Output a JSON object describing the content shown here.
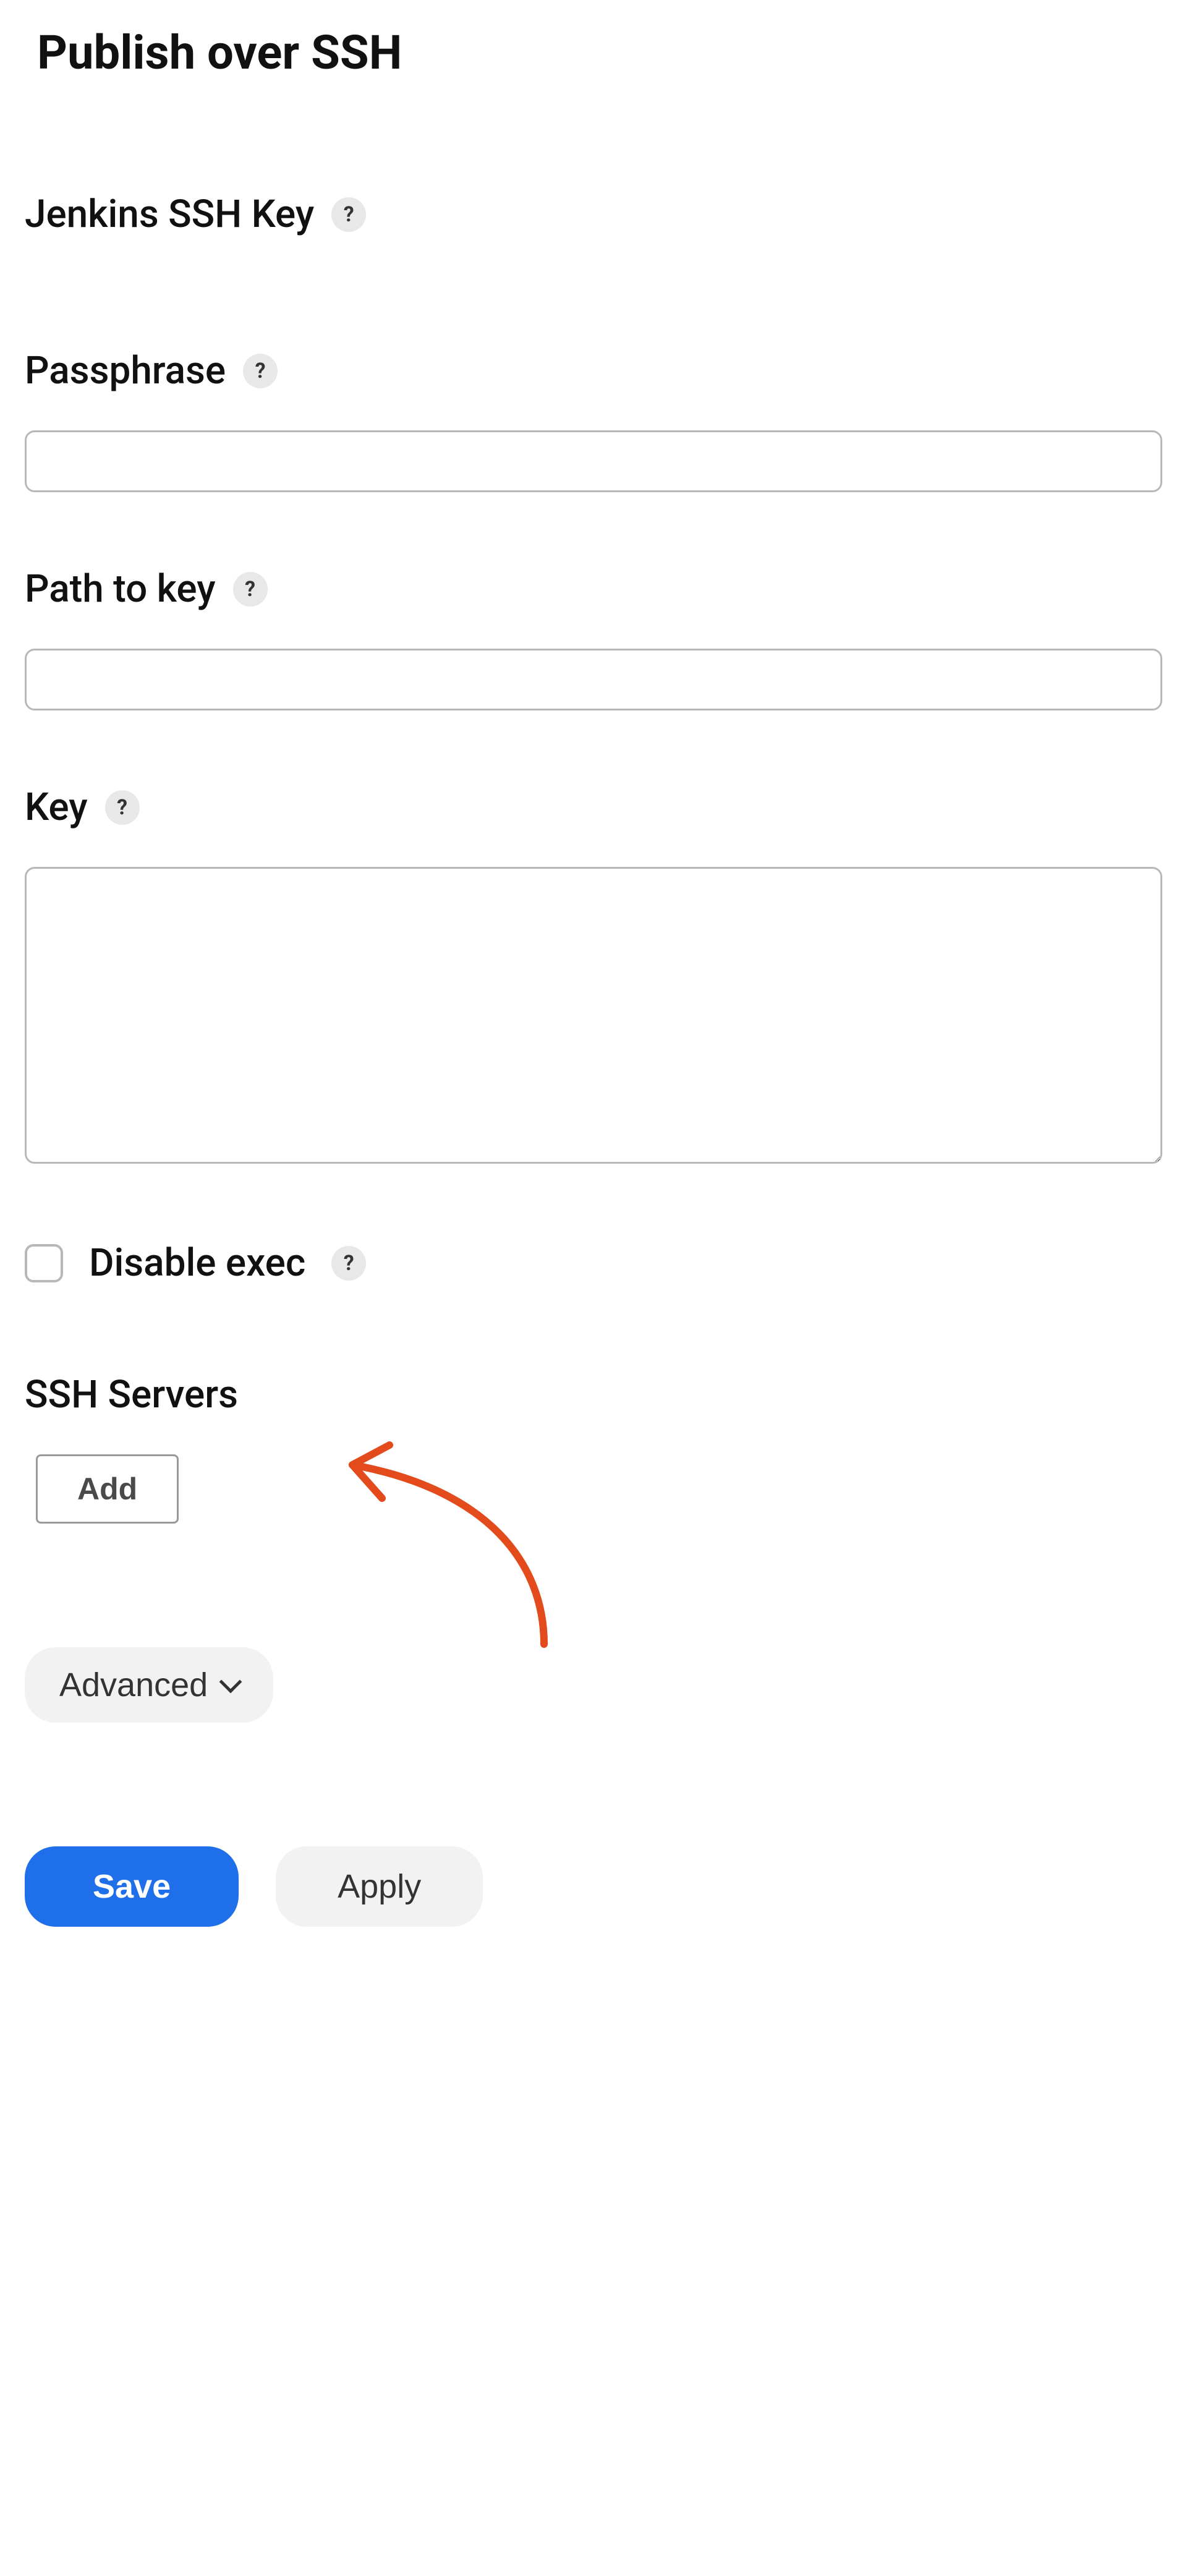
{
  "section": {
    "title": "Publish over SSH"
  },
  "jenkinsKey": {
    "heading": "Jenkins SSH Key"
  },
  "passphrase": {
    "label": "Passphrase",
    "value": ""
  },
  "pathToKey": {
    "label": "Path to key",
    "value": ""
  },
  "key": {
    "label": "Key",
    "value": ""
  },
  "disableExec": {
    "label": "Disable exec",
    "checked": false
  },
  "sshServers": {
    "heading": "SSH Servers",
    "addLabel": "Add",
    "advancedLabel": "Advanced"
  },
  "buttons": {
    "save": "Save",
    "apply": "Apply"
  },
  "helpGlyph": "?"
}
